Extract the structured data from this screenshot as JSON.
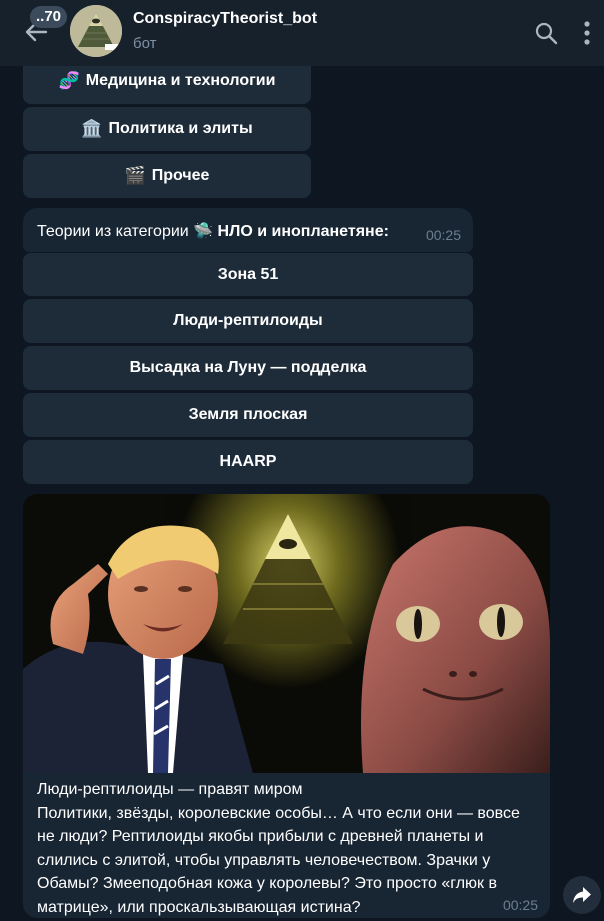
{
  "header": {
    "unread_count": "..70",
    "bot_name": "ConspiracyTheorist_bot",
    "status": "бот",
    "avatar_badge": "САМ ТЫ ДУРАЧОК"
  },
  "category_buttons": [
    {
      "emoji": "🧬",
      "label": "Медицина и технологии"
    },
    {
      "emoji": "🏛️",
      "label": "Политика и элиты"
    },
    {
      "emoji": "🎬",
      "label": "Прочее"
    }
  ],
  "message": {
    "prefix": "Теории из категории",
    "emoji": "🛸",
    "category": "НЛО и инопланетяне:",
    "time": "00:25"
  },
  "theory_buttons": [
    {
      "label": "Зона 51"
    },
    {
      "label": "Люди-рептилоиды"
    },
    {
      "label": "Высадка на Луну — подделка"
    },
    {
      "label": "Земля плоская"
    },
    {
      "label": "HAARP"
    }
  ],
  "photo_message": {
    "caption_title": "Люди-рептилоиды — правят миром",
    "caption_body": "Политики, звёзды, королевские особы… А что если они — вовсе не люди? Рептилоиды якобы прибыли с древней планеты и слились с элитой, чтобы управлять человечеством. Зрачки у Обамы? Змееподобная кожа у королевы? Это просто «глюк в матрице», или проскальзывающая истина?",
    "time": "00:25"
  },
  "icons": {
    "back": "back-arrow-icon",
    "search": "search-icon",
    "menu": "more-vertical-icon",
    "share": "share-forward-icon"
  },
  "colors": {
    "background": "#0e1621",
    "header": "#17212b",
    "button": "#1e2c3a",
    "bubble": "#182533",
    "muted_text": "#6d7f8f"
  }
}
